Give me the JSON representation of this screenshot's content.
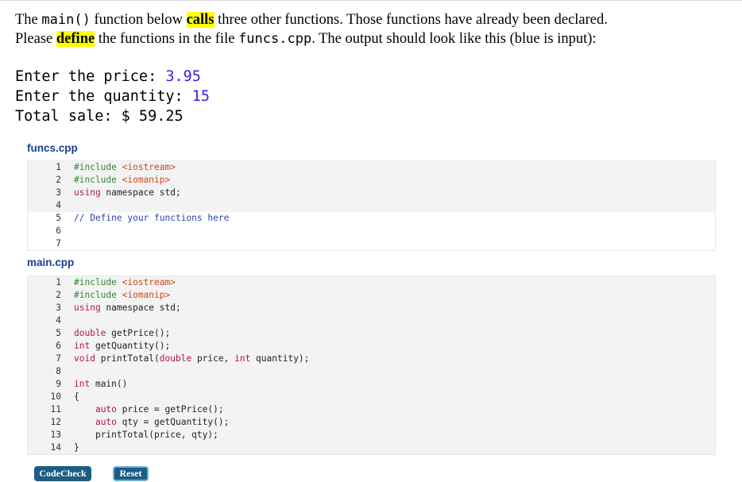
{
  "prompt": {
    "p1": "The ",
    "main_code": "main()",
    "p2": " function below ",
    "calls": "calls",
    "p3": " three other functions. Those functions have already been declared.",
    "p4": "Please ",
    "define": "define",
    "p5": " the functions in the file ",
    "funcs_code": "funcs.cpp",
    "p6": ". The output should look like this (blue is input):"
  },
  "sample": {
    "l1_label": "Enter the price: ",
    "l1_input": "3.95",
    "l2_label": "Enter the quantity: ",
    "l2_input": "15",
    "l3": "Total sale: $ 59.25"
  },
  "funcs_file": {
    "title": "funcs.cpp",
    "lines": [
      {
        "n": "1",
        "parts": [
          {
            "t": "#include ",
            "c": "pp"
          },
          {
            "t": "<iostream>",
            "c": "str"
          }
        ]
      },
      {
        "n": "2",
        "parts": [
          {
            "t": "#include ",
            "c": "pp"
          },
          {
            "t": "<iomanip>",
            "c": "str"
          }
        ]
      },
      {
        "n": "3",
        "parts": [
          {
            "t": "using",
            "c": "kw"
          },
          {
            "t": " namespace std;",
            "c": ""
          }
        ]
      },
      {
        "n": "4",
        "parts": []
      },
      {
        "n": "5",
        "parts": [
          {
            "t": "// Define your functions here",
            "c": "cmt"
          }
        ],
        "editable": true
      },
      {
        "n": "6",
        "parts": [],
        "editable": true
      },
      {
        "n": "7",
        "parts": [],
        "editable": true
      }
    ]
  },
  "main_file": {
    "title": "main.cpp",
    "lines": [
      {
        "n": "1",
        "parts": [
          {
            "t": "#include ",
            "c": "pp"
          },
          {
            "t": "<iostream>",
            "c": "str"
          }
        ]
      },
      {
        "n": "2",
        "parts": [
          {
            "t": "#include ",
            "c": "pp"
          },
          {
            "t": "<iomanip>",
            "c": "str"
          }
        ]
      },
      {
        "n": "3",
        "parts": [
          {
            "t": "using",
            "c": "kw"
          },
          {
            "t": " namespace std;",
            "c": ""
          }
        ]
      },
      {
        "n": "4",
        "parts": []
      },
      {
        "n": "5",
        "parts": [
          {
            "t": "double",
            "c": "kw"
          },
          {
            "t": " getPrice();",
            "c": ""
          }
        ]
      },
      {
        "n": "6",
        "parts": [
          {
            "t": "int",
            "c": "kw"
          },
          {
            "t": " getQuantity();",
            "c": ""
          }
        ]
      },
      {
        "n": "7",
        "parts": [
          {
            "t": "void",
            "c": "kw"
          },
          {
            "t": " printTotal(",
            "c": ""
          },
          {
            "t": "double",
            "c": "kw"
          },
          {
            "t": " price, ",
            "c": ""
          },
          {
            "t": "int",
            "c": "kw"
          },
          {
            "t": " quantity);",
            "c": ""
          }
        ]
      },
      {
        "n": "8",
        "parts": []
      },
      {
        "n": "9",
        "parts": [
          {
            "t": "int",
            "c": "kw"
          },
          {
            "t": " main()",
            "c": ""
          }
        ]
      },
      {
        "n": "10",
        "parts": [
          {
            "t": "{",
            "c": ""
          }
        ]
      },
      {
        "n": "11",
        "parts": [
          {
            "t": "    ",
            "c": ""
          },
          {
            "t": "auto",
            "c": "kw"
          },
          {
            "t": " price = getPrice();",
            "c": ""
          }
        ]
      },
      {
        "n": "12",
        "parts": [
          {
            "t": "    ",
            "c": ""
          },
          {
            "t": "auto",
            "c": "kw"
          },
          {
            "t": " qty = getQuantity();",
            "c": ""
          }
        ]
      },
      {
        "n": "13",
        "parts": [
          {
            "t": "    printTotal(price, qty);",
            "c": ""
          }
        ]
      },
      {
        "n": "14",
        "parts": [
          {
            "t": "}",
            "c": ""
          }
        ]
      }
    ]
  },
  "buttons": {
    "codecheck": "CodeCheck",
    "reset": "Reset"
  },
  "colors": {
    "input_blue": "#3a1fe6",
    "highlight": "#ffff00",
    "button": "#1b5d83",
    "file_title": "#1a3f8f"
  }
}
